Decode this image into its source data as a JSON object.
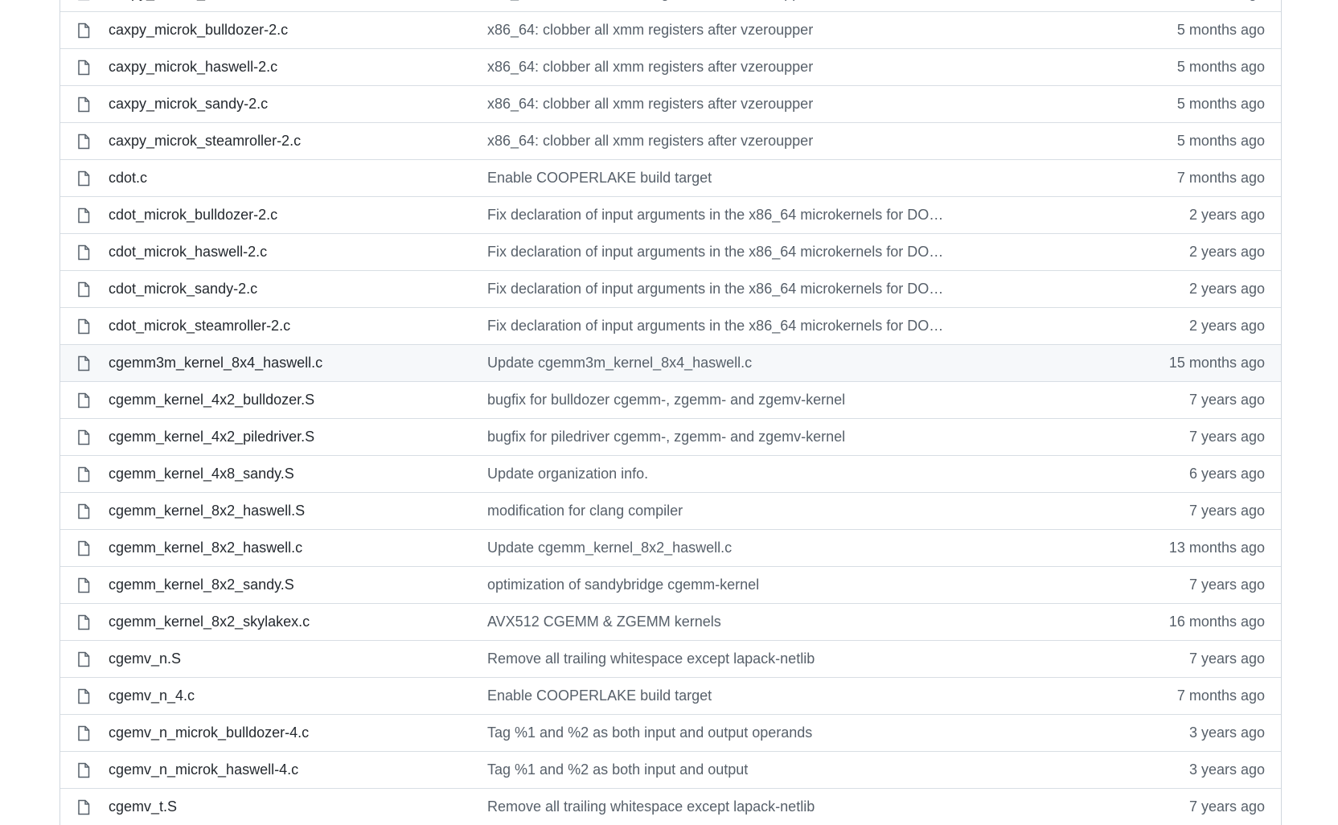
{
  "files": [
    {
      "name": "caxpy_microk_bulldozer-2.c",
      "message": "x86_64: clobber all xmm registers after vzeroupper",
      "age": "5 months ago"
    },
    {
      "name": "caxpy_microk_bulldozer-2.c",
      "message": "x86_64: clobber all xmm registers after vzeroupper",
      "age": "5 months ago"
    },
    {
      "name": "caxpy_microk_haswell-2.c",
      "message": "x86_64: clobber all xmm registers after vzeroupper",
      "age": "5 months ago"
    },
    {
      "name": "caxpy_microk_sandy-2.c",
      "message": "x86_64: clobber all xmm registers after vzeroupper",
      "age": "5 months ago"
    },
    {
      "name": "caxpy_microk_steamroller-2.c",
      "message": "x86_64: clobber all xmm registers after vzeroupper",
      "age": "5 months ago"
    },
    {
      "name": "cdot.c",
      "message": "Enable COOPERLAKE build target",
      "age": "7 months ago"
    },
    {
      "name": "cdot_microk_bulldozer-2.c",
      "message": "Fix declaration of input arguments in the x86_64 microkernels for DOT…",
      "age": "2 years ago"
    },
    {
      "name": "cdot_microk_haswell-2.c",
      "message": "Fix declaration of input arguments in the x86_64 microkernels for DOT…",
      "age": "2 years ago"
    },
    {
      "name": "cdot_microk_sandy-2.c",
      "message": "Fix declaration of input arguments in the x86_64 microkernels for DOT…",
      "age": "2 years ago"
    },
    {
      "name": "cdot_microk_steamroller-2.c",
      "message": "Fix declaration of input arguments in the x86_64 microkernels for DOT…",
      "age": "2 years ago"
    },
    {
      "name": "cgemm3m_kernel_8x4_haswell.c",
      "message": "Update cgemm3m_kernel_8x4_haswell.c",
      "age": "15 months ago",
      "highlight": true
    },
    {
      "name": "cgemm_kernel_4x2_bulldozer.S",
      "message": "bugfix for bulldozer cgemm-, zgemm- and zgemv-kernel",
      "age": "7 years ago"
    },
    {
      "name": "cgemm_kernel_4x2_piledriver.S",
      "message": "bugfix for piledriver cgemm-, zgemm- and zgemv-kernel",
      "age": "7 years ago"
    },
    {
      "name": "cgemm_kernel_4x8_sandy.S",
      "message": "Update organization info.",
      "age": "6 years ago"
    },
    {
      "name": "cgemm_kernel_8x2_haswell.S",
      "message": "modification for clang compiler",
      "age": "7 years ago"
    },
    {
      "name": "cgemm_kernel_8x2_haswell.c",
      "message": "Update cgemm_kernel_8x2_haswell.c",
      "age": "13 months ago"
    },
    {
      "name": "cgemm_kernel_8x2_sandy.S",
      "message": "optimization of sandybridge cgemm-kernel",
      "age": "7 years ago"
    },
    {
      "name": "cgemm_kernel_8x2_skylakex.c",
      "message": "AVX512 CGEMM & ZGEMM kernels",
      "age": "16 months ago"
    },
    {
      "name": "cgemv_n.S",
      "message": "Remove all trailing whitespace except lapack-netlib",
      "age": "7 years ago"
    },
    {
      "name": "cgemv_n_4.c",
      "message": "Enable COOPERLAKE build target",
      "age": "7 months ago"
    },
    {
      "name": "cgemv_n_microk_bulldozer-4.c",
      "message": "Tag %1 and %2 as both input and output operands",
      "age": "3 years ago"
    },
    {
      "name": "cgemv_n_microk_haswell-4.c",
      "message": "Tag %1 and %2 as both input and output",
      "age": "3 years ago"
    },
    {
      "name": "cgemv_t.S",
      "message": "Remove all trailing whitespace except lapack-netlib",
      "age": "7 years ago"
    }
  ],
  "icons": {
    "file": "file-icon"
  },
  "colors": {
    "text": "#24292f",
    "muted": "#57606a",
    "border": "#d8dee4",
    "highlight": "#f6f8fa"
  }
}
